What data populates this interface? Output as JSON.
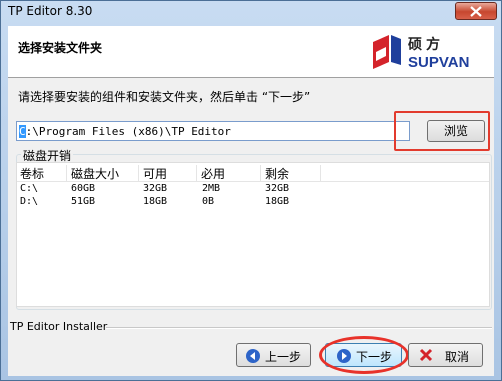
{
  "window": {
    "title": "TP Editor 8.30"
  },
  "header": {
    "title": "选择安装文件夹",
    "logo_text": "硕方",
    "logo_brand": "SUPVAN"
  },
  "instruction": "请选择要安装的组件和安装文件夹，然后单击 “下一步”",
  "path": {
    "first_char": "C",
    "rest": ":\\Program Files (x86)\\TP Editor"
  },
  "browse_label": "浏览",
  "disk_group_label": "磁盘开销",
  "columns": [
    "卷标",
    "磁盘大小",
    "可用",
    "必用",
    "剩余"
  ],
  "rows": [
    {
      "label": "C:\\",
      "size": "60GB",
      "available": "32GB",
      "required": "2MB",
      "remaining": "32GB"
    },
    {
      "label": "D:\\",
      "size": "51GB",
      "available": "18GB",
      "required": "0B",
      "remaining": "18GB"
    }
  ],
  "footer_label": "TP Editor Installer",
  "buttons": {
    "back": "上一步",
    "next": "下一步",
    "cancel": "取消"
  },
  "colors": {
    "title_bar": "#b9d1ea",
    "close_button": "#c7472f",
    "brand_blue": "#1f3f9c",
    "logo_red": "#d4232b",
    "annotation_red": "#e8322a"
  }
}
